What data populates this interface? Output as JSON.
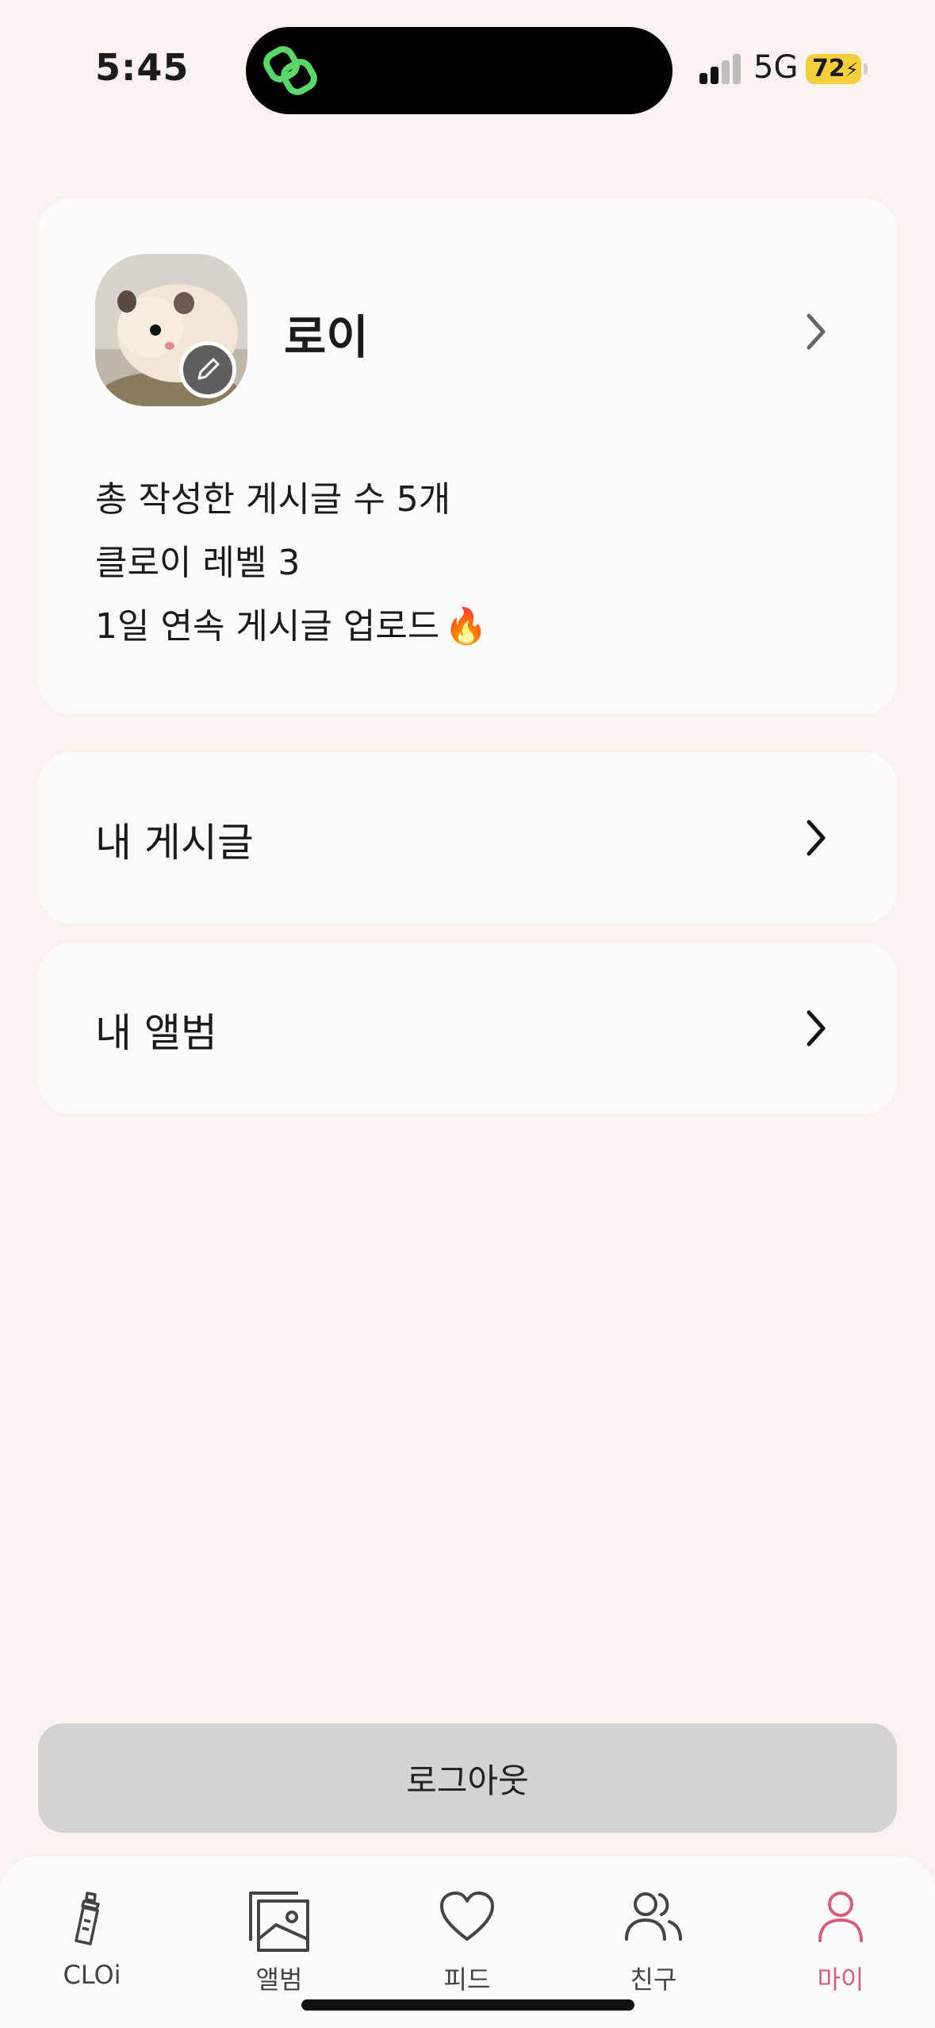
{
  "status_bar": {
    "time": "5:45",
    "network": "5G",
    "battery": "72",
    "icons": [
      "app-link-logo-icon",
      "signal-icon",
      "battery-charging-icon"
    ]
  },
  "profile": {
    "name": "로이",
    "avatar_icon": "hamster-photo",
    "edit_icon": "pencil-icon",
    "stats": {
      "total_posts": "총 작성한 게시글 수 5개",
      "level": "클로이 레벨 3",
      "streak": "1일 연속 게시글 업로드",
      "streak_icon": "🔥"
    }
  },
  "menu": {
    "my_posts": "내 게시글",
    "my_album": "내 앨범"
  },
  "logout_label": "로그아웃",
  "tab_bar": {
    "active_color": "#D2607A",
    "items": [
      {
        "label": "CLOi",
        "icon": "baby-bottle-icon"
      },
      {
        "label": "앨범",
        "icon": "album-icon"
      },
      {
        "label": "피드",
        "icon": "heart-icon"
      },
      {
        "label": "친구",
        "icon": "friends-icon"
      },
      {
        "label": "마이",
        "icon": "person-icon"
      }
    ]
  }
}
